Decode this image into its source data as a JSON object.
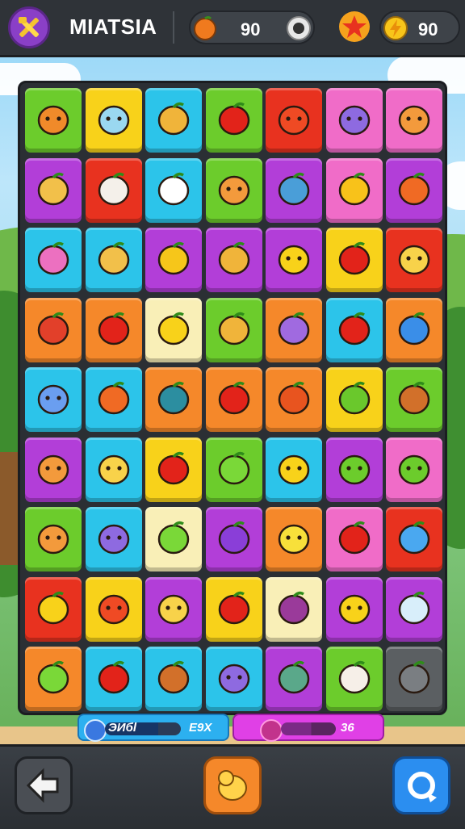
{
  "header": {
    "title": "MIATSIA",
    "coins_value": "90",
    "gems_value": "90",
    "menu_icon": "hammer-wrench-icon",
    "coin_icon": "fruit-coin-icon",
    "add_icon": "plus-icon",
    "star_icon": "star-badge-icon",
    "gem_icon": "lightning-gem-icon"
  },
  "board": {
    "rows": 9,
    "cols": 7,
    "tiles": [
      [
        "green",
        "orange-face"
      ],
      [
        "yellow",
        "blob-face"
      ],
      [
        "cyan",
        "carrot"
      ],
      [
        "green",
        "apple-red"
      ],
      [
        "red",
        "tomato-face"
      ],
      [
        "pink",
        "blob-purple"
      ],
      [
        "pink",
        "face-orange"
      ],
      [
        "magenta",
        "sticks"
      ],
      [
        "red",
        "box-striped"
      ],
      [
        "cyan",
        "star-card"
      ],
      [
        "green",
        "face-orange"
      ],
      [
        "magenta",
        "card"
      ],
      [
        "pink",
        "letter-a"
      ],
      [
        "magenta",
        "bag"
      ],
      [
        "cyan",
        "flower-pink"
      ],
      [
        "cyan",
        "sticks"
      ],
      [
        "magenta",
        "spiral-yellow"
      ],
      [
        "magenta",
        "carrot"
      ],
      [
        "magenta",
        "sun-face"
      ],
      [
        "yellow",
        "apple-red"
      ],
      [
        "red",
        "face-yellow"
      ],
      [
        "orange",
        "strawberry"
      ],
      [
        "orange",
        "apple-red"
      ],
      [
        "cream",
        "lemon"
      ],
      [
        "green",
        "carrot"
      ],
      [
        "orange",
        "cup"
      ],
      [
        "cyan",
        "apple-red"
      ],
      [
        "orange",
        "spiral-blue"
      ],
      [
        "cyan",
        "blob-blue"
      ],
      [
        "cyan",
        "bag"
      ],
      [
        "orange",
        "leaf-ball"
      ],
      [
        "orange",
        "strawberry-red"
      ],
      [
        "orange",
        "onion"
      ],
      [
        "yellow",
        "leaf"
      ],
      [
        "green",
        "ice-cream"
      ],
      [
        "magenta",
        "face-orange"
      ],
      [
        "cyan",
        "face-yellow"
      ],
      [
        "yellow",
        "apple-red"
      ],
      [
        "green",
        "lime"
      ],
      [
        "cyan",
        "sun-face"
      ],
      [
        "magenta",
        "blob-green"
      ],
      [
        "pink",
        "blob-green"
      ],
      [
        "green",
        "face-orange"
      ],
      [
        "cyan",
        "blob-purple"
      ],
      [
        "cream",
        "lime"
      ],
      [
        "magenta",
        "plum"
      ],
      [
        "orange",
        "lemon-face"
      ],
      [
        "pink",
        "apple-red"
      ],
      [
        "red",
        "flower-blue"
      ],
      [
        "red",
        "lemon"
      ],
      [
        "yellow",
        "tomato-face"
      ],
      [
        "magenta",
        "face-yellow"
      ],
      [
        "yellow",
        "strawberry-red"
      ],
      [
        "cream",
        "egg-purple"
      ],
      [
        "magenta",
        "ghost-yellow"
      ],
      [
        "magenta",
        "house"
      ],
      [
        "orange",
        "lime"
      ],
      [
        "cyan",
        "apple-red"
      ],
      [
        "cyan",
        "ice-cream"
      ],
      [
        "cyan",
        "blob-purple"
      ],
      [
        "magenta",
        "jar"
      ],
      [
        "green",
        "cup-white"
      ],
      [
        "gray",
        "grater"
      ]
    ]
  },
  "progress": {
    "left_label": "ЭИбl",
    "left_percent_text": "Е9Х",
    "left_fill": 0.7,
    "right_value": "36",
    "right_fill": 0.55
  },
  "footer": {
    "back_icon": "back-arrow-icon",
    "center_icon": "chick-icon",
    "right_icon": "refresh-icon"
  },
  "colors": {
    "green": "#6ccc2c",
    "yellow": "#f8d21a",
    "cyan": "#2cc4ea",
    "red": "#e8321f",
    "pink": "#f06cc8",
    "magenta": "#b23ed8",
    "orange": "#f5882a",
    "cream": "#f9efb7",
    "gray": "#5b5f62"
  }
}
